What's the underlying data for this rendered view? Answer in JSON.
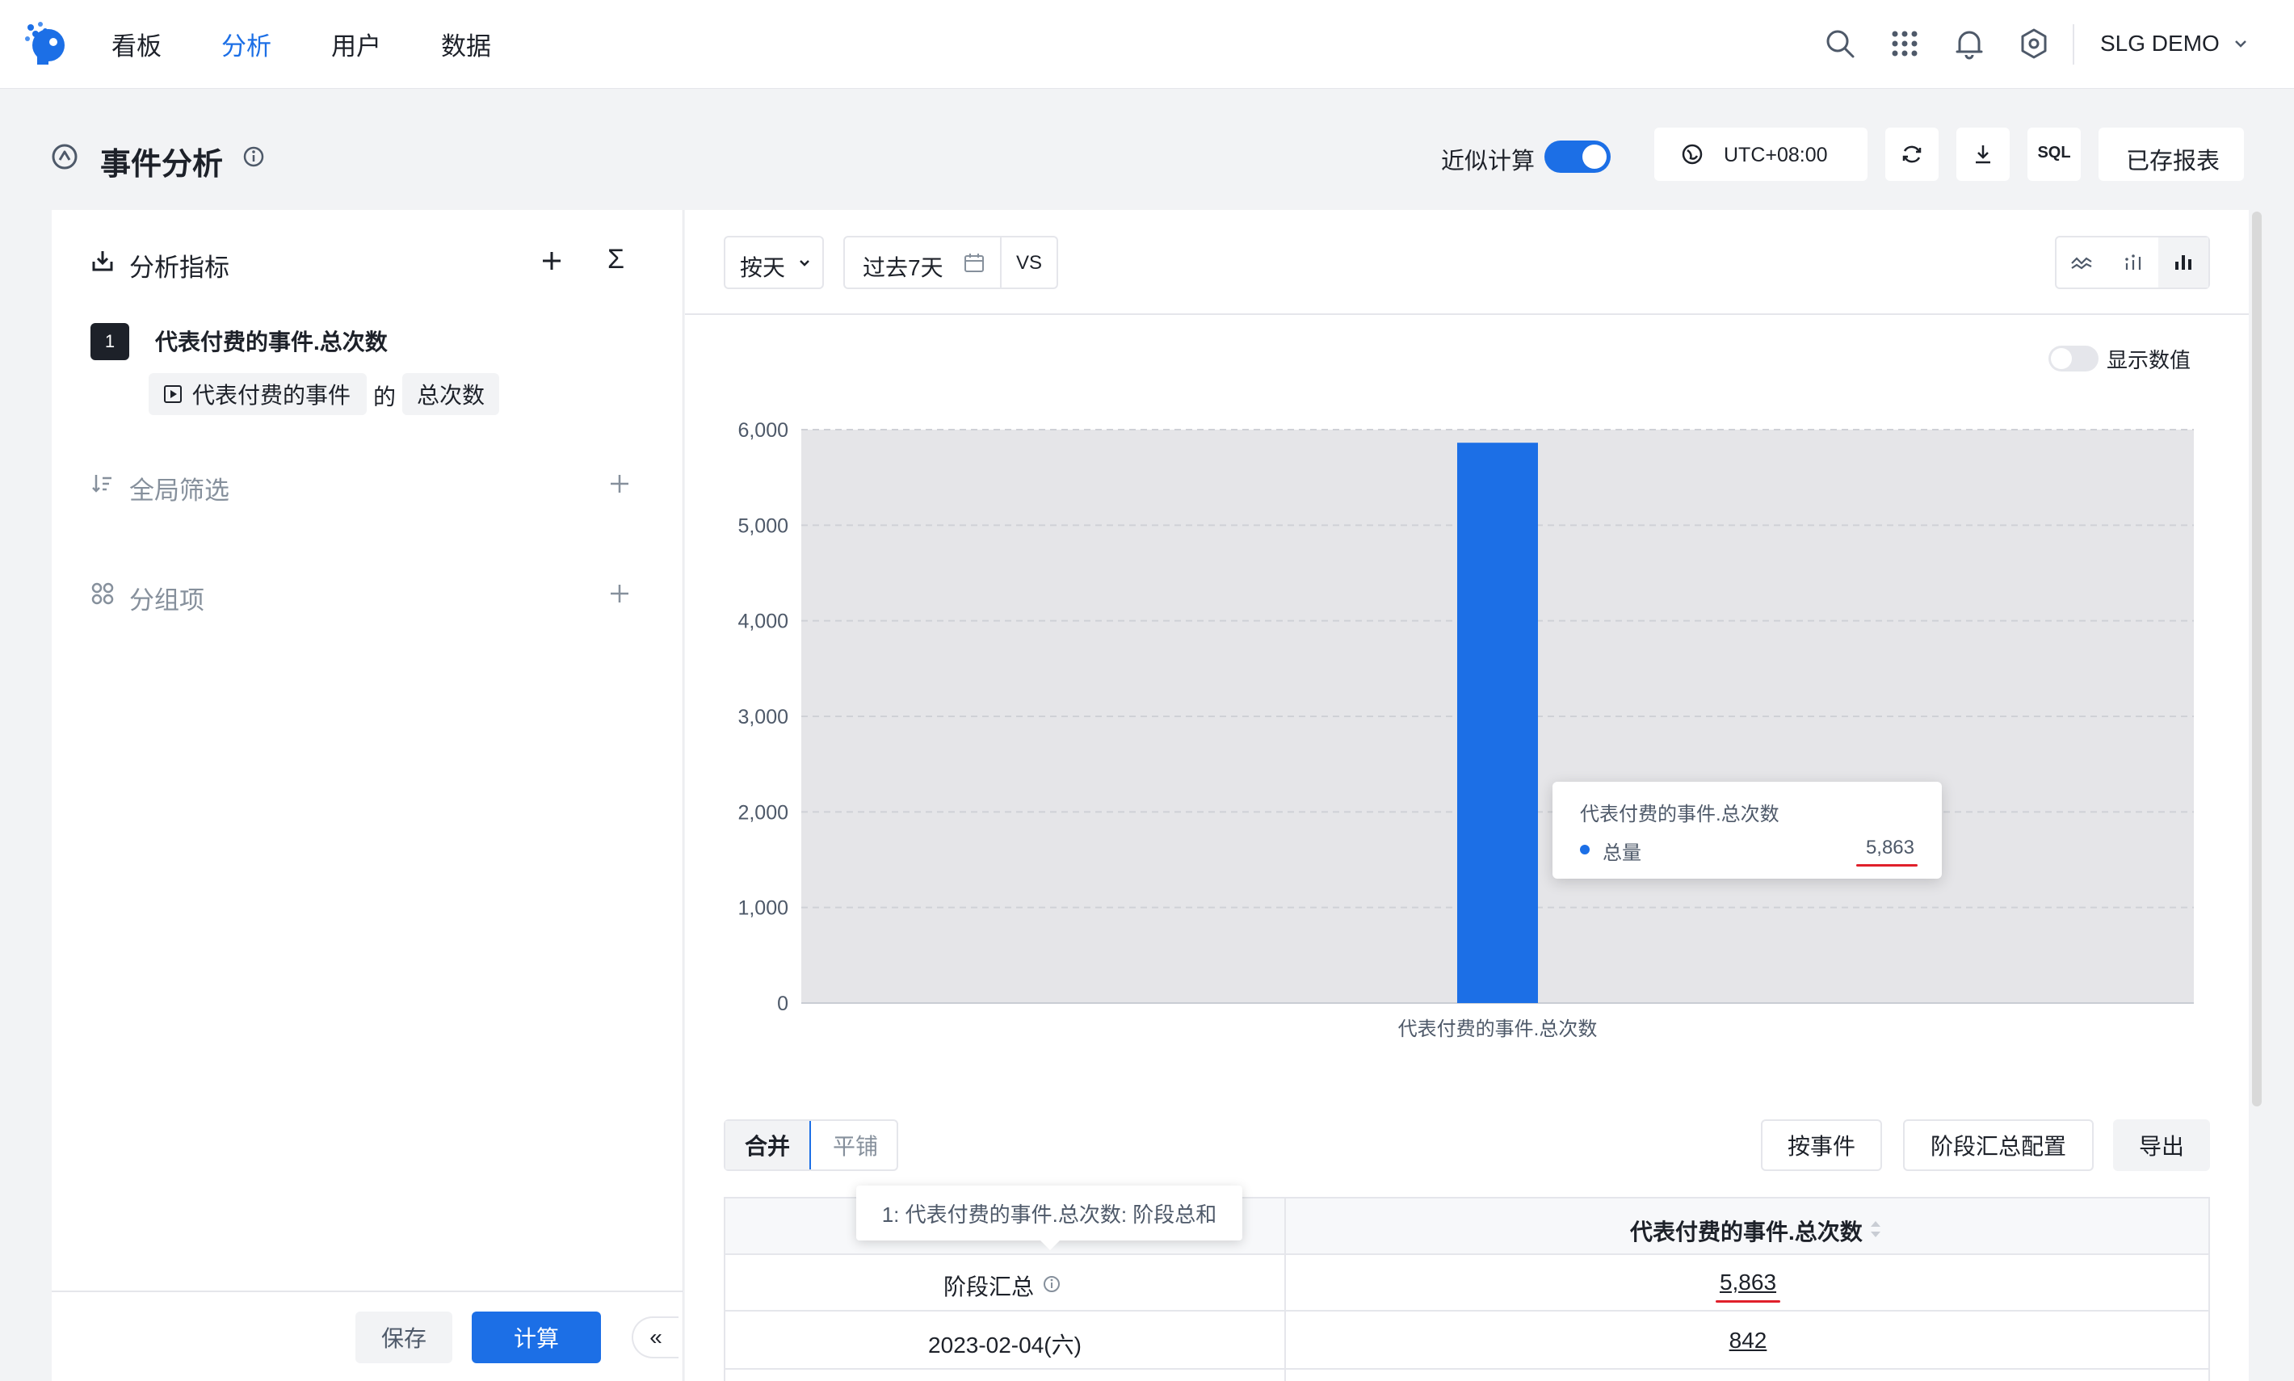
{
  "nav": {
    "items": [
      "看板",
      "分析",
      "用户",
      "数据"
    ],
    "active_index": 1,
    "user_label": "SLG DEMO",
    "icons": [
      "search-icon",
      "apps-grid-icon",
      "bell-icon",
      "gear-icon"
    ]
  },
  "header": {
    "title": "事件分析",
    "approx_label": "近似计算",
    "approx_enabled": true,
    "timezone": "UTC+08:00",
    "sql_label": "SQL",
    "saved_reports": "已存报表"
  },
  "left": {
    "metrics_title": "分析指标",
    "sigma": "Σ",
    "metric_index": "1",
    "metric_name": "代表付费的事件.总次数",
    "event_chip": "代表付费的事件",
    "de": "的",
    "agg_chip": "总次数",
    "filter_title": "全局筛选",
    "group_title": "分组项",
    "save": "保存",
    "calc": "计算",
    "collapse": "«"
  },
  "toolbar": {
    "granularity": "按天",
    "range": "过去7天",
    "vs": "VS",
    "show_values_label": "显示数值",
    "show_values_enabled": false
  },
  "tooltip": {
    "title": "代表付费的事件.总次数",
    "label": "总量",
    "value": "5,863"
  },
  "chart_data": {
    "type": "bar",
    "categories": [
      "代表付费的事件.总次数"
    ],
    "series": [
      {
        "name": "总量",
        "values": [
          5863
        ]
      }
    ],
    "ylim": [
      0,
      6000
    ],
    "yticks": [
      0,
      1000,
      2000,
      3000,
      4000,
      5000,
      6000
    ],
    "ytick_labels": [
      "0",
      "1,000",
      "2,000",
      "3,000",
      "4,000",
      "5,000",
      "6,000"
    ],
    "grid": true,
    "bar_color": "#1c6fe6"
  },
  "table": {
    "tab_merge": "合并",
    "tab_tile": "平铺",
    "btn_by_event": "按事件",
    "btn_stage_config": "阶段汇总配置",
    "btn_export": "导出",
    "header": "代表付费的事件.总次数",
    "rows": [
      {
        "label": "阶段汇总",
        "value": "5,863"
      },
      {
        "label": "2023-02-04(六)",
        "value": "842"
      }
    ],
    "hover_tip": "1: 代表付费的事件.总次数: 阶段总和"
  }
}
